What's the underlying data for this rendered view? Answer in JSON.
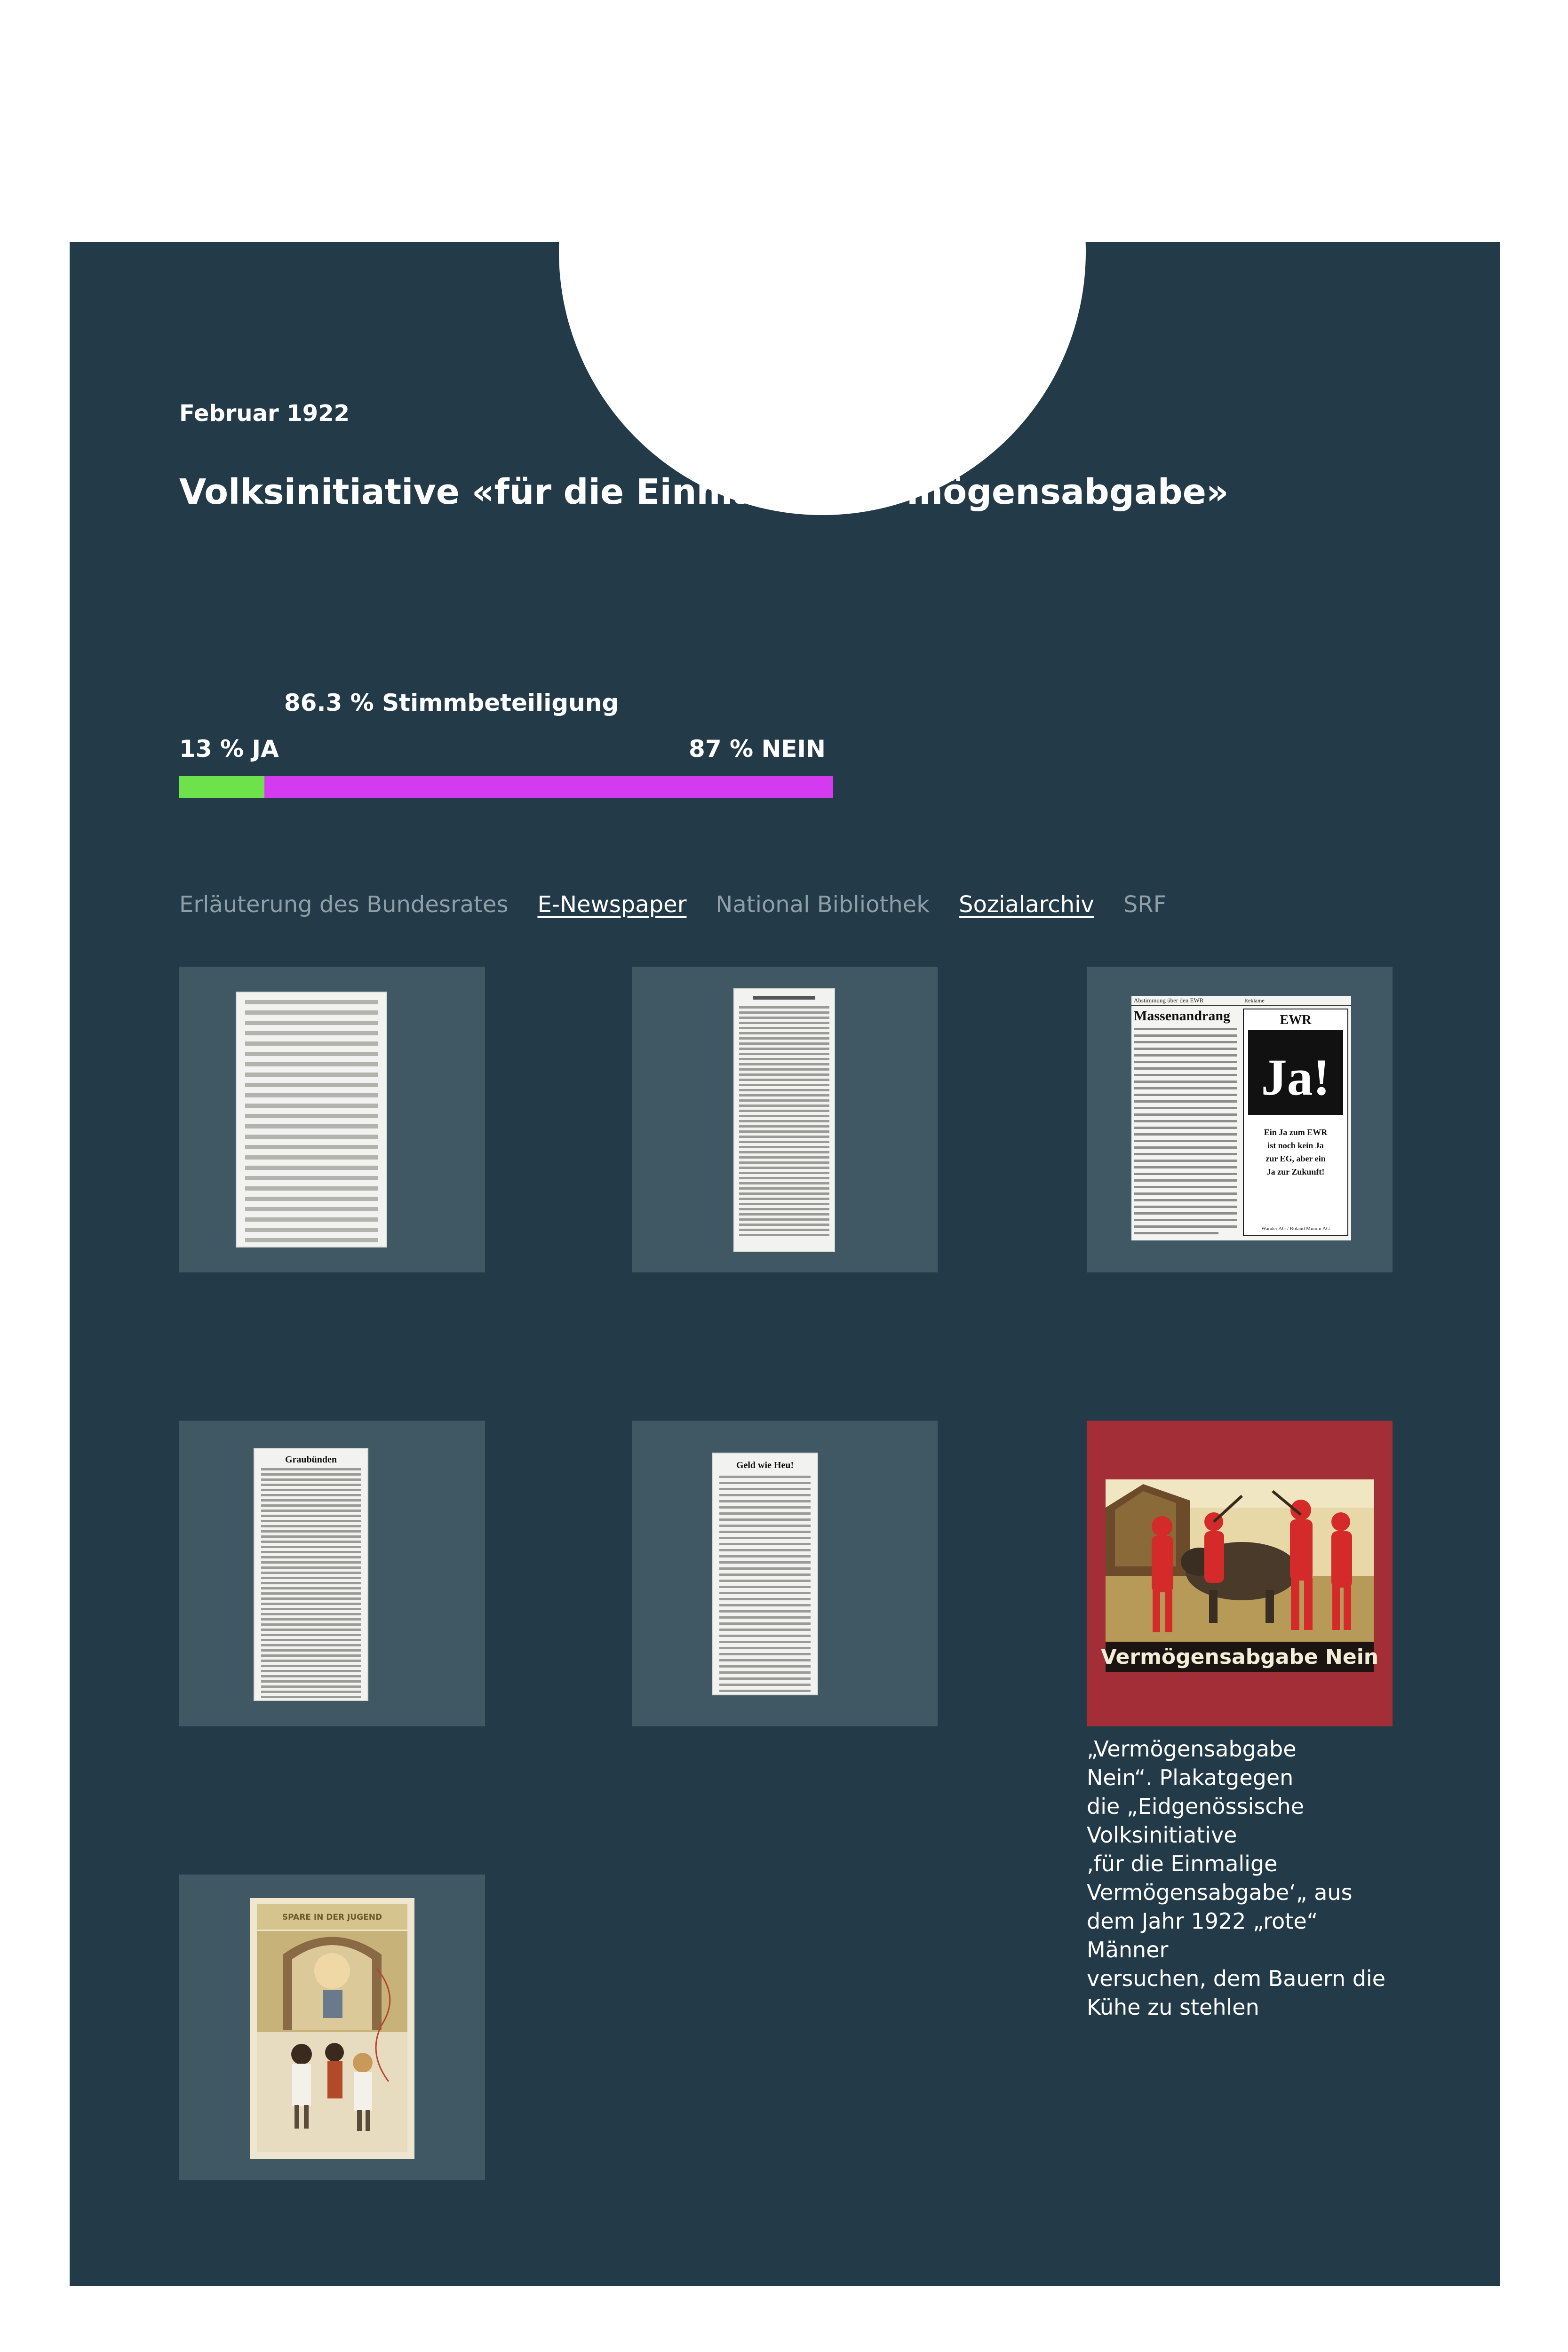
{
  "vote": {
    "date": "Februar 1922",
    "title": "Volksinitiative «für die Einmalige Vermögensabgabe»",
    "turnout_label": "86.3 % Stimmbeteiligung",
    "yes_label": "13 % JA",
    "no_label": "87 % NEIN",
    "yes_percent": 13,
    "no_percent": 87,
    "yes_color": "#6ee24a",
    "no_color": "#d43bf0"
  },
  "sources": {
    "tabs": [
      {
        "label": "Erläuterung des Bundesrates",
        "active": false
      },
      {
        "label": "E-Newspaper",
        "active": true
      },
      {
        "label": "National Bibliothek",
        "active": false
      },
      {
        "label": "Sozialarchiv",
        "active": true
      },
      {
        "label": "SRF",
        "active": false
      }
    ]
  },
  "gallery": {
    "ewr_clipping": {
      "header_left": "Abstimmung über den EWR",
      "header_right": "Reklame",
      "headline": "Massenandrang",
      "box_title": "EWR",
      "box_big": "Ja!",
      "box_text": "Ein Ja zum EWR ist noch kein Ja zur EG, aber ein Ja zur Zukunft!",
      "box_footer": "Wander AG / Roland Mumm AG"
    },
    "graubuenden_clipping": {
      "headline": "Graubünden"
    },
    "geld_clipping": {
      "headline": "Geld wie Heu!"
    },
    "poster": {
      "text": "Vermögensabgabe Nein",
      "background": "#a32e38"
    },
    "poster_caption": [
      "„Vermögensabgabe",
      "Nein“. Plakatgegen",
      "die „Eidgenössische",
      "Volksinitiative",
      "‚für die Einmalige",
      "Vermögensabgabe‘„ aus",
      "dem Jahr 1922 „rote“ Männer",
      "versuchen, dem Bauern die",
      "Kühe zu stehlen"
    ],
    "postcard": {
      "sign": "SPARE IN DER JUGEND"
    }
  }
}
